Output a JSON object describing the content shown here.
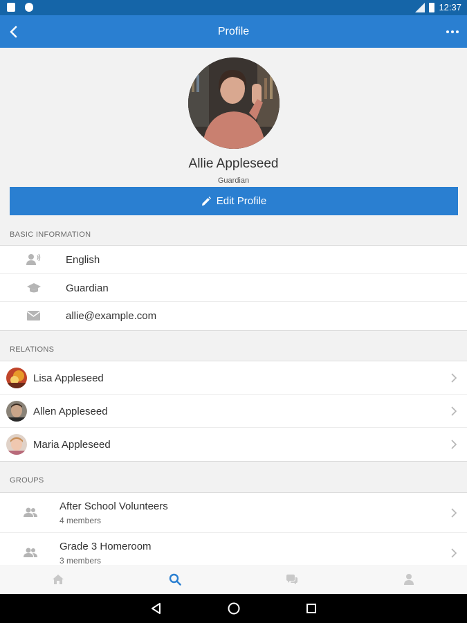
{
  "status_bar": {
    "time": "12:37"
  },
  "app_bar": {
    "title": "Profile"
  },
  "profile": {
    "name": "Allie Appleseed",
    "role": "Guardian",
    "edit_label": "Edit Profile"
  },
  "basic_info": {
    "header": "BASIC INFORMATION",
    "items": [
      {
        "icon": "language-icon",
        "text": "English"
      },
      {
        "icon": "graduation-cap-icon",
        "text": "Guardian"
      },
      {
        "icon": "mail-icon",
        "text": "allie@example.com"
      }
    ]
  },
  "relations": {
    "header": "RELATIONS",
    "items": [
      {
        "name": "Lisa Appleseed"
      },
      {
        "name": "Allen Appleseed"
      },
      {
        "name": "Maria Appleseed"
      }
    ]
  },
  "groups": {
    "header": "GROUPS",
    "items": [
      {
        "name": "After School Volunteers",
        "count": "4 members"
      },
      {
        "name": "Grade 3 Homeroom",
        "count": "3 members"
      }
    ]
  },
  "tabs": [
    {
      "icon": "home-icon",
      "active": false
    },
    {
      "icon": "search-icon",
      "active": true
    },
    {
      "icon": "chat-icon",
      "active": false
    },
    {
      "icon": "person-icon",
      "active": false
    }
  ],
  "colors": {
    "primary": "#2a7fd1",
    "status_bar": "#1565a8",
    "background": "#f2f2f2",
    "icon_gray": "#b5b5b5"
  }
}
